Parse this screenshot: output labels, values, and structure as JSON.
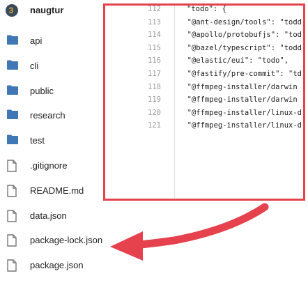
{
  "repo": {
    "name": "naugtur"
  },
  "files": [
    {
      "type": "folder",
      "name": "api"
    },
    {
      "type": "folder",
      "name": "cli"
    },
    {
      "type": "folder",
      "name": "public"
    },
    {
      "type": "folder",
      "name": "research"
    },
    {
      "type": "folder",
      "name": "test"
    },
    {
      "type": "file",
      "name": ".gitignore"
    },
    {
      "type": "file",
      "name": "README.md"
    },
    {
      "type": "file",
      "name": "data.json"
    },
    {
      "type": "file",
      "name": "package-lock.json"
    },
    {
      "type": "file",
      "name": "package.json"
    }
  ],
  "code": {
    "lines": [
      {
        "n": "112",
        "text": "\"todo\": {"
      },
      {
        "n": "113",
        "text": "  \"@ant-design/tools\": \"todd"
      },
      {
        "n": "114",
        "text": "  \"@apollo/protobufjs\": \"tod"
      },
      {
        "n": "115",
        "text": "  \"@bazel/typescript\": \"todd"
      },
      {
        "n": "116",
        "text": "  \"@elastic/eui\": \"todo\","
      },
      {
        "n": "117",
        "text": "  \"@fastify/pre-commit\": \"td"
      },
      {
        "n": "118",
        "text": "  \"@ffmpeg-installer/darwin"
      },
      {
        "n": "119",
        "text": "  \"@ffmpeg-installer/darwin"
      },
      {
        "n": "120",
        "text": "  \"@ffmpeg-installer/linux-d"
      },
      {
        "n": "121",
        "text": "  \"@ffmpeg-installer/linux-d"
      }
    ]
  },
  "colors": {
    "accent": "#e5424d",
    "folder": "#3f78b4",
    "icon_gray": "#777777"
  }
}
